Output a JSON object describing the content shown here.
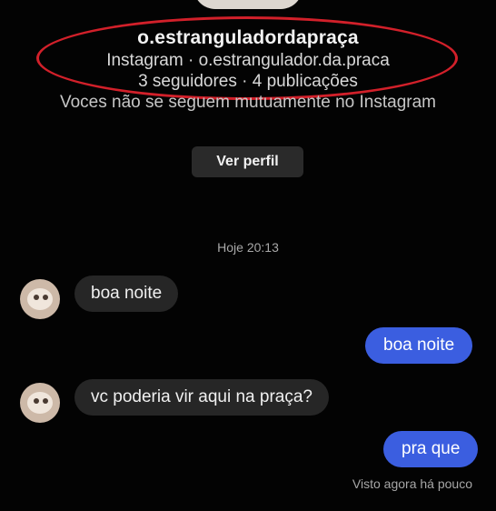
{
  "profile": {
    "username": "o.estranguladordapraça",
    "source_line": "Instagram · o.estrangulador.da.praca",
    "stats_line": "3 seguidores · 4 publicações",
    "mutual_text": "Voces não se seguem mutuamente no Instagram",
    "view_profile_label": "Ver perfil"
  },
  "chat": {
    "timestamp": "Hoje 20:13",
    "messages": [
      {
        "from": "them",
        "text": "boa noite"
      },
      {
        "from": "me",
        "text": "boa noite"
      },
      {
        "from": "them",
        "text": "vc poderia vir aqui na praça?"
      },
      {
        "from": "me",
        "text": "pra que"
      }
    ],
    "seen_status": "Visto agora há pouco"
  },
  "colors": {
    "background": "#030303",
    "outgoing_bubble": "#3b5ee0",
    "incoming_bubble": "#262626",
    "highlight_oval": "#d2202a"
  }
}
